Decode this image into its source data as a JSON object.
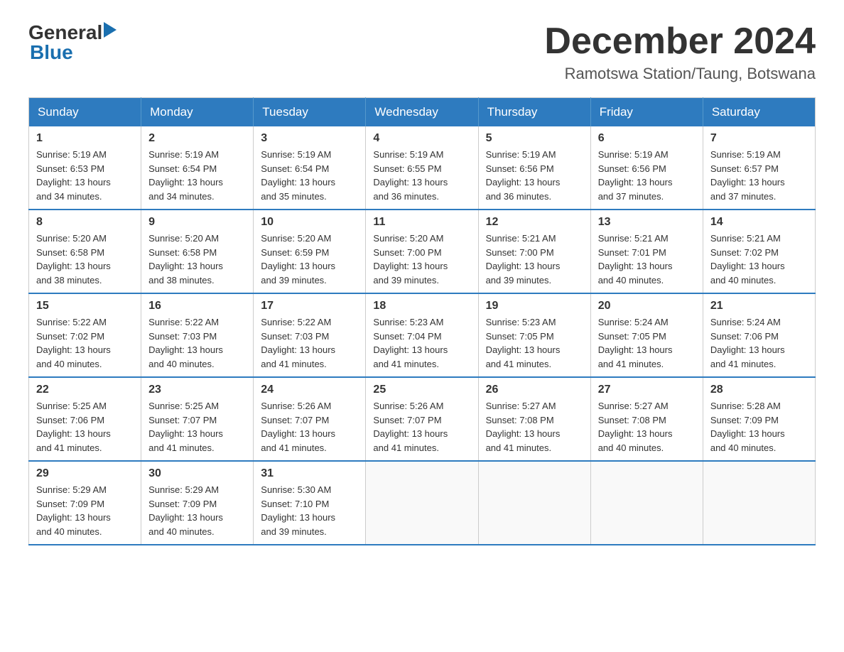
{
  "header": {
    "logo_general": "General",
    "logo_blue": "Blue",
    "month_title": "December 2024",
    "location": "Ramotswa Station/Taung, Botswana"
  },
  "days_of_week": [
    "Sunday",
    "Monday",
    "Tuesday",
    "Wednesday",
    "Thursday",
    "Friday",
    "Saturday"
  ],
  "weeks": [
    [
      {
        "day": "1",
        "sunrise": "5:19 AM",
        "sunset": "6:53 PM",
        "daylight": "13 hours and 34 minutes."
      },
      {
        "day": "2",
        "sunrise": "5:19 AM",
        "sunset": "6:54 PM",
        "daylight": "13 hours and 34 minutes."
      },
      {
        "day": "3",
        "sunrise": "5:19 AM",
        "sunset": "6:54 PM",
        "daylight": "13 hours and 35 minutes."
      },
      {
        "day": "4",
        "sunrise": "5:19 AM",
        "sunset": "6:55 PM",
        "daylight": "13 hours and 36 minutes."
      },
      {
        "day": "5",
        "sunrise": "5:19 AM",
        "sunset": "6:56 PM",
        "daylight": "13 hours and 36 minutes."
      },
      {
        "day": "6",
        "sunrise": "5:19 AM",
        "sunset": "6:56 PM",
        "daylight": "13 hours and 37 minutes."
      },
      {
        "day": "7",
        "sunrise": "5:19 AM",
        "sunset": "6:57 PM",
        "daylight": "13 hours and 37 minutes."
      }
    ],
    [
      {
        "day": "8",
        "sunrise": "5:20 AM",
        "sunset": "6:58 PM",
        "daylight": "13 hours and 38 minutes."
      },
      {
        "day": "9",
        "sunrise": "5:20 AM",
        "sunset": "6:58 PM",
        "daylight": "13 hours and 38 minutes."
      },
      {
        "day": "10",
        "sunrise": "5:20 AM",
        "sunset": "6:59 PM",
        "daylight": "13 hours and 39 minutes."
      },
      {
        "day": "11",
        "sunrise": "5:20 AM",
        "sunset": "7:00 PM",
        "daylight": "13 hours and 39 minutes."
      },
      {
        "day": "12",
        "sunrise": "5:21 AM",
        "sunset": "7:00 PM",
        "daylight": "13 hours and 39 minutes."
      },
      {
        "day": "13",
        "sunrise": "5:21 AM",
        "sunset": "7:01 PM",
        "daylight": "13 hours and 40 minutes."
      },
      {
        "day": "14",
        "sunrise": "5:21 AM",
        "sunset": "7:02 PM",
        "daylight": "13 hours and 40 minutes."
      }
    ],
    [
      {
        "day": "15",
        "sunrise": "5:22 AM",
        "sunset": "7:02 PM",
        "daylight": "13 hours and 40 minutes."
      },
      {
        "day": "16",
        "sunrise": "5:22 AM",
        "sunset": "7:03 PM",
        "daylight": "13 hours and 40 minutes."
      },
      {
        "day": "17",
        "sunrise": "5:22 AM",
        "sunset": "7:03 PM",
        "daylight": "13 hours and 41 minutes."
      },
      {
        "day": "18",
        "sunrise": "5:23 AM",
        "sunset": "7:04 PM",
        "daylight": "13 hours and 41 minutes."
      },
      {
        "day": "19",
        "sunrise": "5:23 AM",
        "sunset": "7:05 PM",
        "daylight": "13 hours and 41 minutes."
      },
      {
        "day": "20",
        "sunrise": "5:24 AM",
        "sunset": "7:05 PM",
        "daylight": "13 hours and 41 minutes."
      },
      {
        "day": "21",
        "sunrise": "5:24 AM",
        "sunset": "7:06 PM",
        "daylight": "13 hours and 41 minutes."
      }
    ],
    [
      {
        "day": "22",
        "sunrise": "5:25 AM",
        "sunset": "7:06 PM",
        "daylight": "13 hours and 41 minutes."
      },
      {
        "day": "23",
        "sunrise": "5:25 AM",
        "sunset": "7:07 PM",
        "daylight": "13 hours and 41 minutes."
      },
      {
        "day": "24",
        "sunrise": "5:26 AM",
        "sunset": "7:07 PM",
        "daylight": "13 hours and 41 minutes."
      },
      {
        "day": "25",
        "sunrise": "5:26 AM",
        "sunset": "7:07 PM",
        "daylight": "13 hours and 41 minutes."
      },
      {
        "day": "26",
        "sunrise": "5:27 AM",
        "sunset": "7:08 PM",
        "daylight": "13 hours and 41 minutes."
      },
      {
        "day": "27",
        "sunrise": "5:27 AM",
        "sunset": "7:08 PM",
        "daylight": "13 hours and 40 minutes."
      },
      {
        "day": "28",
        "sunrise": "5:28 AM",
        "sunset": "7:09 PM",
        "daylight": "13 hours and 40 minutes."
      }
    ],
    [
      {
        "day": "29",
        "sunrise": "5:29 AM",
        "sunset": "7:09 PM",
        "daylight": "13 hours and 40 minutes."
      },
      {
        "day": "30",
        "sunrise": "5:29 AM",
        "sunset": "7:09 PM",
        "daylight": "13 hours and 40 minutes."
      },
      {
        "day": "31",
        "sunrise": "5:30 AM",
        "sunset": "7:10 PM",
        "daylight": "13 hours and 39 minutes."
      },
      null,
      null,
      null,
      null
    ]
  ],
  "labels": {
    "sunrise": "Sunrise:",
    "sunset": "Sunset:",
    "daylight": "Daylight:"
  }
}
